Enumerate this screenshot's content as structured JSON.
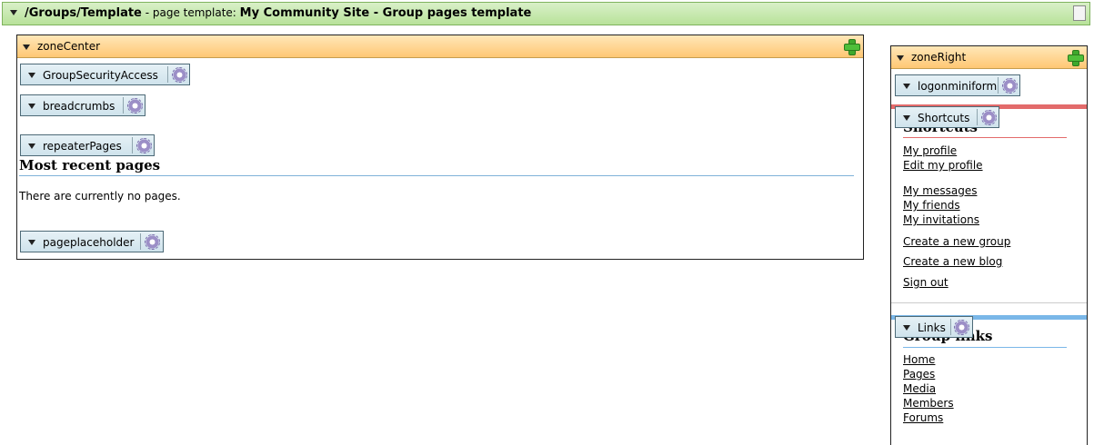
{
  "top_bar": {
    "path": "/Groups/Template",
    "separator": " - page template: ",
    "template_name": "My Community Site - Group pages template"
  },
  "zone_center": {
    "label": "zoneCenter",
    "webparts": {
      "group_security": "GroupSecurityAccess",
      "breadcrumbs": "breadcrumbs",
      "repeater": "repeaterPages",
      "placeholder": "pageplaceholder"
    },
    "heading": "Most recent pages",
    "empty_text": "There are currently no pages."
  },
  "zone_right": {
    "label": "zoneRight",
    "webparts": {
      "logon": "logonminiform",
      "shortcuts": "Shortcuts",
      "links": "Links"
    },
    "shortcuts_heading": "Shortcuts",
    "shortcut_links": [
      "My profile",
      "Edit my profile",
      "My messages",
      "My friends",
      "My invitations",
      "Create a new group",
      "Create a new blog",
      "Sign out"
    ],
    "links_heading": "Group links",
    "group_links": [
      "Home",
      "Pages",
      "Media",
      "Members",
      "Forums"
    ]
  },
  "colors": {
    "template_bar": "#b8e29a",
    "zone_header": "#ffc774",
    "webpart_handle": "#cfe3ec",
    "shortcuts_accent": "#e36b6b",
    "links_accent": "#7ab7e8"
  }
}
